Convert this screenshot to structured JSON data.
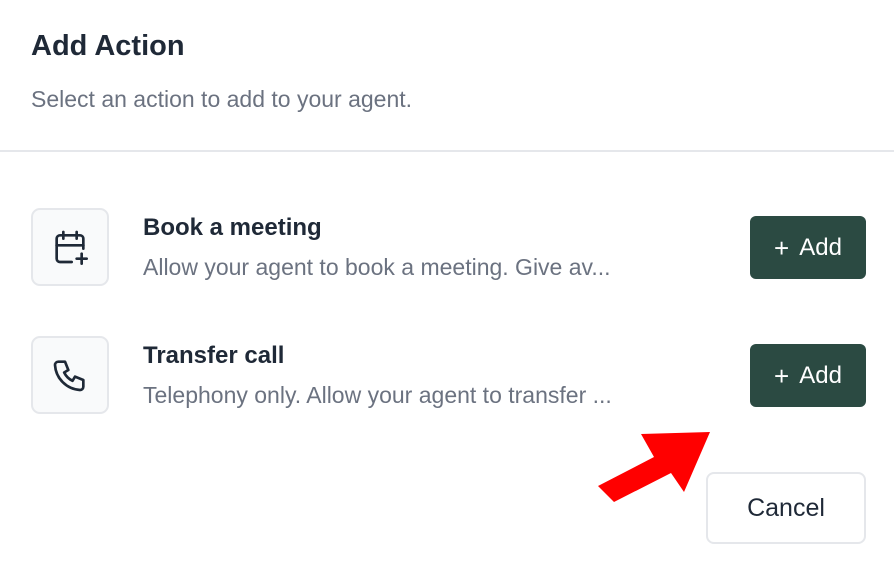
{
  "dialog": {
    "title": "Add Action",
    "subtitle": "Select an action to add to your agent."
  },
  "actions": [
    {
      "name": "Book a meeting",
      "description": "Allow your agent to book a meeting. Give av...",
      "icon": "calendar-plus-icon",
      "add_label": "Add"
    },
    {
      "name": "Transfer call",
      "description": "Telephony only. Allow your agent to transfer ...",
      "icon": "phone-icon",
      "add_label": "Add"
    }
  ],
  "footer": {
    "cancel_label": "Cancel"
  },
  "colors": {
    "primary_button": "#2b4a42",
    "annotation_arrow": "#ff0000",
    "text_primary": "#1f2937",
    "text_secondary": "#6b7280"
  }
}
